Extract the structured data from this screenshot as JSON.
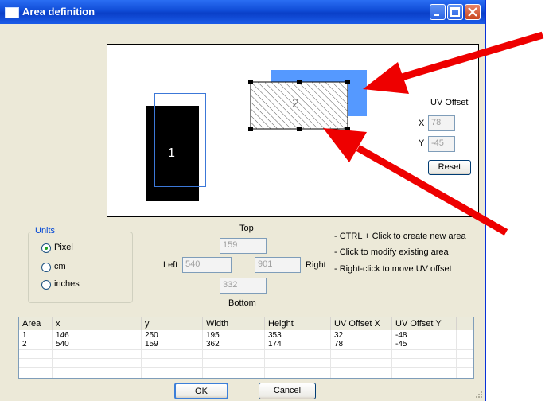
{
  "window": {
    "title": "Area definition"
  },
  "canvas": {
    "areas": [
      {
        "label": "1"
      },
      {
        "label": "2"
      }
    ]
  },
  "uv_offset": {
    "title": "UV Offset",
    "x_label": "X",
    "x_value": "78",
    "y_label": "Y",
    "y_value": "-45",
    "reset_label": "Reset"
  },
  "units": {
    "legend": "Units",
    "options": [
      {
        "label": "Pixel",
        "selected": true
      },
      {
        "label": "cm",
        "selected": false
      },
      {
        "label": "inches",
        "selected": false
      }
    ]
  },
  "bounds": {
    "top_label": "Top",
    "top_value": "159",
    "left_label": "Left",
    "left_value": "540",
    "right_label": "Right",
    "right_value": "901",
    "bottom_label": "Bottom",
    "bottom_value": "332"
  },
  "help": [
    "- CTRL + Click to create new area",
    "- Click to modify existing area",
    "- Right-click to move UV offset"
  ],
  "table": {
    "columns": [
      "Area",
      "x",
      "y",
      "Width",
      "Height",
      "UV Offset X",
      "UV Offset Y"
    ],
    "rows": [
      [
        "1",
        "146",
        "250",
        "195",
        "353",
        "32",
        "-48"
      ],
      [
        "2",
        "540",
        "159",
        "362",
        "174",
        "78",
        "-45"
      ]
    ]
  },
  "buttons": {
    "ok": "OK",
    "cancel": "Cancel"
  },
  "colors": {
    "title_bar": "#0a3fc8",
    "selection_blue": "#5599ff",
    "annotation_arrow": "#ee0000"
  }
}
